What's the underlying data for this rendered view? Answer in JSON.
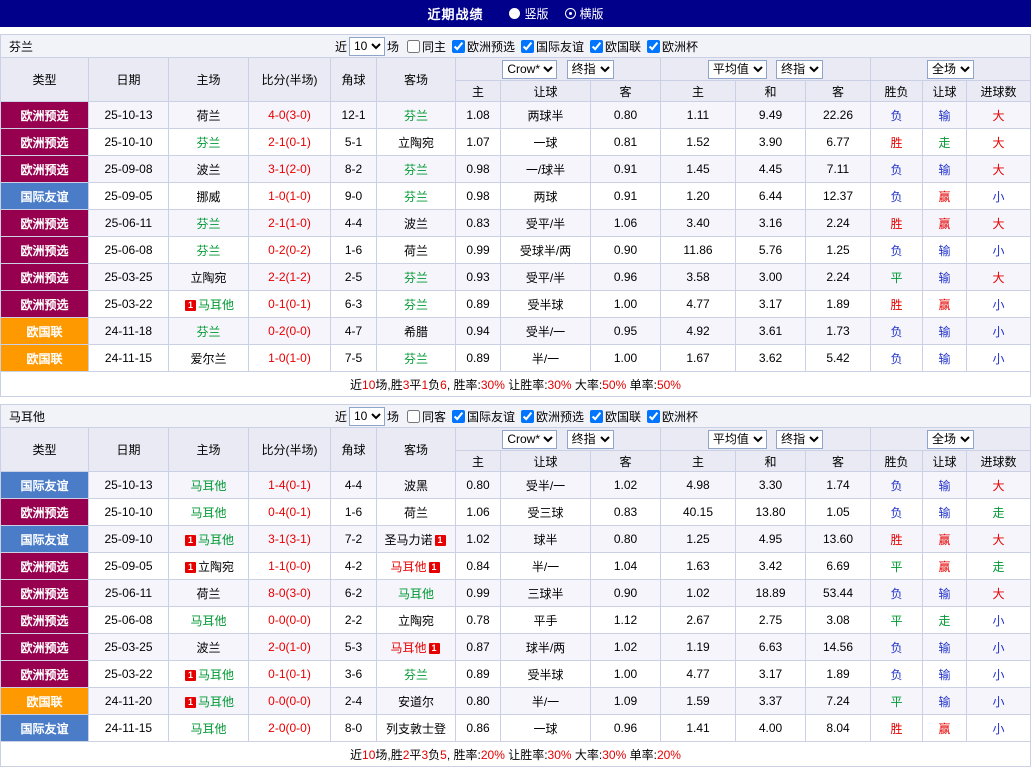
{
  "topbar": {
    "title": "近期战绩",
    "layout_options": [
      {
        "label": "竖版",
        "selected": false
      },
      {
        "label": "横版",
        "selected": true
      }
    ]
  },
  "red_card_label": "1",
  "league_colors": {
    "欧洲预选": "#97004E",
    "国际友谊": "#4A7CC7",
    "欧国联": "#FF9900"
  },
  "team_colors": {
    "focus": "#009933",
    "normal": "#000000",
    "sent": "#E60000"
  },
  "result_colors": {
    "胜": "#E60000",
    "赢": "#E60000",
    "大": "#E60000",
    "平": "#009933",
    "走": "#009933",
    "负": "#2233CC",
    "输": "#2233CC",
    "小": "#2233CC"
  },
  "score_color": "#E60000",
  "columns": {
    "type": "类型",
    "date": "日期",
    "home": "主场",
    "score": "比分(半场)",
    "corner": "角球",
    "away": "客场",
    "odds_home": "主",
    "odds_line": "让球",
    "odds_away": "客",
    "avg_home": "主",
    "avg_draw": "和",
    "avg_away": "客",
    "res_outcome": "胜负",
    "res_line": "让球",
    "res_goals": "进球数"
  },
  "sections": [
    {
      "team": "芬兰",
      "filters": {
        "prefix": "近",
        "count": "10",
        "suffix": "场",
        "checks": [
          {
            "label": "同主",
            "checked": false
          },
          {
            "label": "欧洲预选",
            "checked": true
          },
          {
            "label": "国际友谊",
            "checked": true
          },
          {
            "label": "欧国联",
            "checked": true
          },
          {
            "label": "欧洲杯",
            "checked": true
          }
        ]
      },
      "dropdowns": {
        "provider": "Crow*",
        "provider_type": "终指",
        "average": "平均值",
        "average_type": "终指",
        "scope": "全场"
      },
      "rows": [
        {
          "league": "欧洲预选",
          "date": "25-10-13",
          "home": {
            "n": "荷兰",
            "c": "normal"
          },
          "score": "4-0(3-0)",
          "corner": "12-1",
          "away": {
            "n": "芬兰",
            "c": "focus"
          },
          "odds": [
            "1.08",
            "两球半",
            "0.80"
          ],
          "avg": [
            "1.11",
            "9.49",
            "22.26"
          ],
          "res": [
            "负",
            "输",
            "大"
          ]
        },
        {
          "league": "欧洲预选",
          "date": "25-10-10",
          "home": {
            "n": "芬兰",
            "c": "focus"
          },
          "score": "2-1(0-1)",
          "corner": "5-1",
          "away": {
            "n": "立陶宛",
            "c": "normal"
          },
          "odds": [
            "1.07",
            "一球",
            "0.81"
          ],
          "avg": [
            "1.52",
            "3.90",
            "6.77"
          ],
          "res": [
            "胜",
            "走",
            "大"
          ]
        },
        {
          "league": "欧洲预选",
          "date": "25-09-08",
          "home": {
            "n": "波兰",
            "c": "normal"
          },
          "score": "3-1(2-0)",
          "corner": "8-2",
          "away": {
            "n": "芬兰",
            "c": "focus"
          },
          "odds": [
            "0.98",
            "一/球半",
            "0.91"
          ],
          "avg": [
            "1.45",
            "4.45",
            "7.11"
          ],
          "res": [
            "负",
            "输",
            "大"
          ]
        },
        {
          "league": "国际友谊",
          "date": "25-09-05",
          "home": {
            "n": "挪威",
            "c": "normal"
          },
          "score": "1-0(1-0)",
          "corner": "9-0",
          "away": {
            "n": "芬兰",
            "c": "focus"
          },
          "odds": [
            "0.98",
            "两球",
            "0.91"
          ],
          "avg": [
            "1.20",
            "6.44",
            "12.37"
          ],
          "res": [
            "负",
            "赢",
            "小"
          ]
        },
        {
          "league": "欧洲预选",
          "date": "25-06-11",
          "home": {
            "n": "芬兰",
            "c": "focus"
          },
          "score": "2-1(1-0)",
          "corner": "4-4",
          "away": {
            "n": "波兰",
            "c": "normal"
          },
          "odds": [
            "0.83",
            "受平/半",
            "1.06"
          ],
          "avg": [
            "3.40",
            "3.16",
            "2.24"
          ],
          "res": [
            "胜",
            "赢",
            "大"
          ]
        },
        {
          "league": "欧洲预选",
          "date": "25-06-08",
          "home": {
            "n": "芬兰",
            "c": "focus"
          },
          "score": "0-2(0-2)",
          "corner": "1-6",
          "away": {
            "n": "荷兰",
            "c": "normal"
          },
          "odds": [
            "0.99",
            "受球半/两",
            "0.90"
          ],
          "avg": [
            "11.86",
            "5.76",
            "1.25"
          ],
          "res": [
            "负",
            "输",
            "小"
          ]
        },
        {
          "league": "欧洲预选",
          "date": "25-03-25",
          "home": {
            "n": "立陶宛",
            "c": "normal"
          },
          "score": "2-2(1-2)",
          "corner": "2-5",
          "away": {
            "n": "芬兰",
            "c": "focus"
          },
          "odds": [
            "0.93",
            "受平/半",
            "0.96"
          ],
          "avg": [
            "3.58",
            "3.00",
            "2.24"
          ],
          "res": [
            "平",
            "输",
            "大"
          ]
        },
        {
          "league": "欧洲预选",
          "date": "25-03-22",
          "home": {
            "n": "马耳他",
            "c": "focus",
            "rc": true
          },
          "score": "0-1(0-1)",
          "corner": "6-3",
          "away": {
            "n": "芬兰",
            "c": "focus"
          },
          "odds": [
            "0.89",
            "受半球",
            "1.00"
          ],
          "avg": [
            "4.77",
            "3.17",
            "1.89"
          ],
          "res": [
            "胜",
            "赢",
            "小"
          ]
        },
        {
          "league": "欧国联",
          "date": "24-11-18",
          "home": {
            "n": "芬兰",
            "c": "focus"
          },
          "score": "0-2(0-0)",
          "corner": "4-7",
          "away": {
            "n": "希腊",
            "c": "normal"
          },
          "odds": [
            "0.94",
            "受半/一",
            "0.95"
          ],
          "avg": [
            "4.92",
            "3.61",
            "1.73"
          ],
          "res": [
            "负",
            "输",
            "小"
          ]
        },
        {
          "league": "欧国联",
          "date": "24-11-15",
          "home": {
            "n": "爱尔兰",
            "c": "normal"
          },
          "score": "1-0(1-0)",
          "corner": "7-5",
          "away": {
            "n": "芬兰",
            "c": "focus"
          },
          "odds": [
            "0.89",
            "半/一",
            "1.00"
          ],
          "avg": [
            "1.67",
            "3.62",
            "5.42"
          ],
          "res": [
            "负",
            "输",
            "小"
          ]
        }
      ],
      "summary": {
        "parts": [
          [
            "近",
            0
          ],
          [
            "10",
            1
          ],
          [
            "场,胜",
            0
          ],
          [
            "3",
            1
          ],
          [
            "平",
            0
          ],
          [
            "1",
            1
          ],
          [
            "负",
            0
          ],
          [
            "6",
            1
          ],
          [
            ", 胜率:",
            0
          ],
          [
            "30%",
            1
          ],
          [
            " 让胜率:",
            0
          ],
          [
            "30%",
            1
          ],
          [
            " 大率:",
            0
          ],
          [
            "50%",
            1
          ],
          [
            " 单率:",
            0
          ],
          [
            "50%",
            1
          ]
        ]
      }
    },
    {
      "team": "马耳他",
      "filters": {
        "prefix": "近",
        "count": "10",
        "suffix": "场",
        "checks": [
          {
            "label": "同客",
            "checked": false
          },
          {
            "label": "国际友谊",
            "checked": true
          },
          {
            "label": "欧洲预选",
            "checked": true
          },
          {
            "label": "欧国联",
            "checked": true
          },
          {
            "label": "欧洲杯",
            "checked": true
          }
        ]
      },
      "dropdowns": {
        "provider": "Crow*",
        "provider_type": "终指",
        "average": "平均值",
        "average_type": "终指",
        "scope": "全场"
      },
      "rows": [
        {
          "league": "国际友谊",
          "date": "25-10-13",
          "home": {
            "n": "马耳他",
            "c": "focus"
          },
          "score": "1-4(0-1)",
          "corner": "4-4",
          "away": {
            "n": "波黑",
            "c": "normal"
          },
          "odds": [
            "0.80",
            "受半/一",
            "1.02"
          ],
          "avg": [
            "4.98",
            "3.30",
            "1.74"
          ],
          "res": [
            "负",
            "输",
            "大"
          ]
        },
        {
          "league": "欧洲预选",
          "date": "25-10-10",
          "home": {
            "n": "马耳他",
            "c": "focus"
          },
          "score": "0-4(0-1)",
          "corner": "1-6",
          "away": {
            "n": "荷兰",
            "c": "normal"
          },
          "odds": [
            "1.06",
            "受三球",
            "0.83"
          ],
          "avg": [
            "40.15",
            "13.80",
            "1.05"
          ],
          "res": [
            "负",
            "输",
            "走"
          ]
        },
        {
          "league": "国际友谊",
          "date": "25-09-10",
          "home": {
            "n": "马耳他",
            "c": "focus",
            "rc": true
          },
          "score": "3-1(3-1)",
          "corner": "7-2",
          "away": {
            "n": "圣马力诺",
            "c": "normal",
            "rc": true
          },
          "odds": [
            "1.02",
            "球半",
            "0.80"
          ],
          "avg": [
            "1.25",
            "4.95",
            "13.60"
          ],
          "res": [
            "胜",
            "赢",
            "大"
          ]
        },
        {
          "league": "欧洲预选",
          "date": "25-09-05",
          "home": {
            "n": "立陶宛",
            "c": "normal",
            "rc": true
          },
          "score": "1-1(0-0)",
          "corner": "4-2",
          "away": {
            "n": "马耳他",
            "c": "sent",
            "rc": true
          },
          "odds": [
            "0.84",
            "半/一",
            "1.04"
          ],
          "avg": [
            "1.63",
            "3.42",
            "6.69"
          ],
          "res": [
            "平",
            "赢",
            "走"
          ]
        },
        {
          "league": "欧洲预选",
          "date": "25-06-11",
          "home": {
            "n": "荷兰",
            "c": "normal"
          },
          "score": "8-0(3-0)",
          "corner": "6-2",
          "away": {
            "n": "马耳他",
            "c": "focus"
          },
          "odds": [
            "0.99",
            "三球半",
            "0.90"
          ],
          "avg": [
            "1.02",
            "18.89",
            "53.44"
          ],
          "res": [
            "负",
            "输",
            "大"
          ]
        },
        {
          "league": "欧洲预选",
          "date": "25-06-08",
          "home": {
            "n": "马耳他",
            "c": "focus"
          },
          "score": "0-0(0-0)",
          "corner": "2-2",
          "away": {
            "n": "立陶宛",
            "c": "normal"
          },
          "odds": [
            "0.78",
            "平手",
            "1.12"
          ],
          "avg": [
            "2.67",
            "2.75",
            "3.08"
          ],
          "res": [
            "平",
            "走",
            "小"
          ]
        },
        {
          "league": "欧洲预选",
          "date": "25-03-25",
          "home": {
            "n": "波兰",
            "c": "normal"
          },
          "score": "2-0(1-0)",
          "corner": "5-3",
          "away": {
            "n": "马耳他",
            "c": "sent",
            "rc": true
          },
          "odds": [
            "0.87",
            "球半/两",
            "1.02"
          ],
          "avg": [
            "1.19",
            "6.63",
            "14.56"
          ],
          "res": [
            "负",
            "输",
            "小"
          ]
        },
        {
          "league": "欧洲预选",
          "date": "25-03-22",
          "home": {
            "n": "马耳他",
            "c": "focus",
            "rc": true
          },
          "score": "0-1(0-1)",
          "corner": "3-6",
          "away": {
            "n": "芬兰",
            "c": "focus"
          },
          "odds": [
            "0.89",
            "受半球",
            "1.00"
          ],
          "avg": [
            "4.77",
            "3.17",
            "1.89"
          ],
          "res": [
            "负",
            "输",
            "小"
          ]
        },
        {
          "league": "欧国联",
          "date": "24-11-20",
          "home": {
            "n": "马耳他",
            "c": "focus",
            "rc": true
          },
          "score": "0-0(0-0)",
          "corner": "2-4",
          "away": {
            "n": "安道尔",
            "c": "normal"
          },
          "odds": [
            "0.80",
            "半/一",
            "1.09"
          ],
          "avg": [
            "1.59",
            "3.37",
            "7.24"
          ],
          "res": [
            "平",
            "输",
            "小"
          ]
        },
        {
          "league": "国际友谊",
          "date": "24-11-15",
          "home": {
            "n": "马耳他",
            "c": "focus"
          },
          "score": "2-0(0-0)",
          "corner": "8-0",
          "away": {
            "n": "列支敦士登",
            "c": "normal"
          },
          "odds": [
            "0.86",
            "一球",
            "0.96"
          ],
          "avg": [
            "1.41",
            "4.00",
            "8.04"
          ],
          "res": [
            "胜",
            "赢",
            "小"
          ]
        }
      ],
      "summary": {
        "parts": [
          [
            "近",
            0
          ],
          [
            "10",
            1
          ],
          [
            "场,胜",
            0
          ],
          [
            "2",
            1
          ],
          [
            "平",
            0
          ],
          [
            "3",
            1
          ],
          [
            "负",
            0
          ],
          [
            "5",
            1
          ],
          [
            ", 胜率:",
            0
          ],
          [
            "20%",
            1
          ],
          [
            " 让胜率:",
            0
          ],
          [
            "30%",
            1
          ],
          [
            " 大率:",
            0
          ],
          [
            "30%",
            1
          ],
          [
            " 单率:",
            0
          ],
          [
            "20%",
            1
          ]
        ]
      }
    }
  ]
}
